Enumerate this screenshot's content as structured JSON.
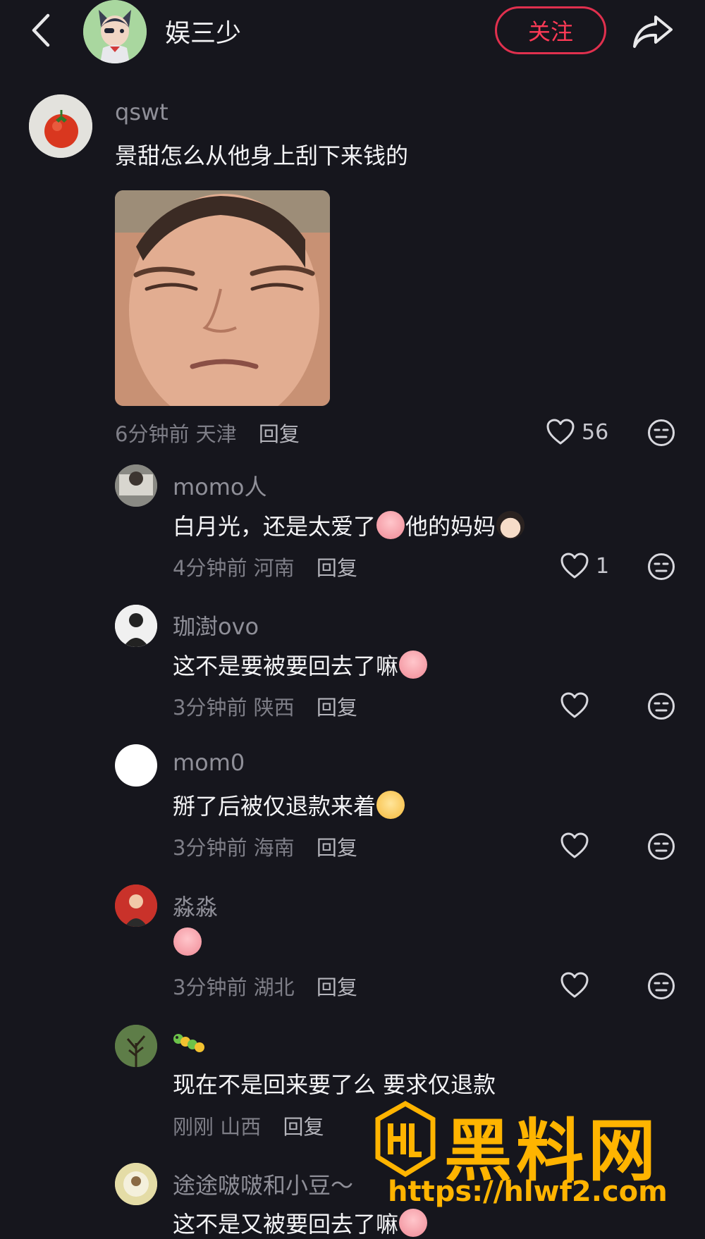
{
  "header": {
    "account_name": "娱三少",
    "follow_label": "关注"
  },
  "comment": {
    "username": "qswt",
    "text": "景甜怎么从他身上刮下来钱的",
    "time": "6分钟前",
    "location": "天津",
    "reply_label": "回复",
    "likes": "56"
  },
  "replies": [
    {
      "username": "momo人",
      "text_a": "白月光，还是太爱了",
      "text_b": "他的妈妈",
      "time": "4分钟前",
      "location": "河南",
      "reply_label": "回复",
      "likes": "1"
    },
    {
      "username": "珈澍ovo",
      "text": "这不是要被要回去了嘛",
      "time": "3分钟前",
      "location": "陕西",
      "reply_label": "回复"
    },
    {
      "username": "mom0",
      "text": "掰了后被仅退款来着",
      "time": "3分钟前",
      "location": "海南",
      "reply_label": "回复"
    },
    {
      "username": "淼淼",
      "text": "",
      "time": "3分钟前",
      "location": "湖北",
      "reply_label": "回复"
    },
    {
      "username": "",
      "text": "现在不是回来要了么 要求仅退款",
      "time": "刚刚",
      "location": "山西",
      "reply_label": "回复"
    },
    {
      "username": "途途啵啵和小豆～",
      "text": "这不是又被要回去了嘛"
    }
  ],
  "watermark": {
    "brand": "黑料网",
    "url": "https://hlwf2.com"
  },
  "colors": {
    "background": "#16161d",
    "follow_red": "#e0304e",
    "watermark_gold": "#ffb400"
  }
}
